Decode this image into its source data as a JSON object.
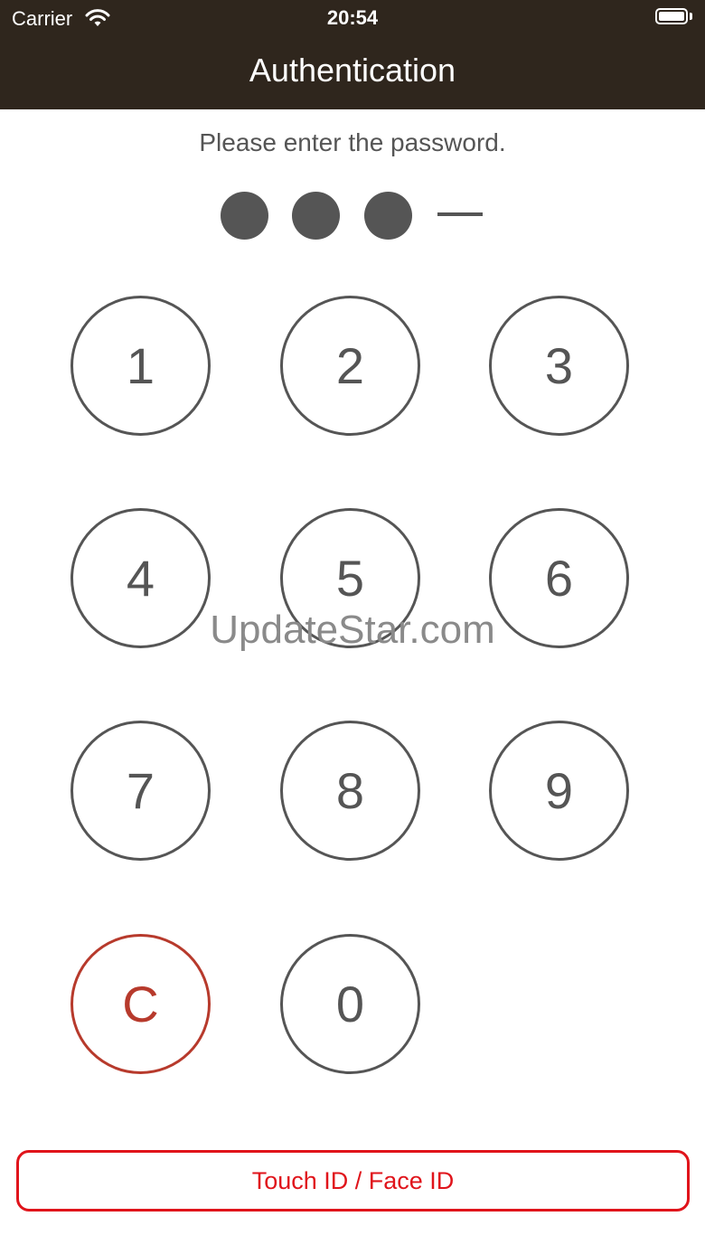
{
  "status_bar": {
    "carrier": "Carrier",
    "time": "20:54"
  },
  "nav": {
    "title": "Authentication"
  },
  "prompt": "Please enter the password.",
  "pin": {
    "entered": 3,
    "length": 4
  },
  "keypad": {
    "keys": [
      "1",
      "2",
      "3",
      "4",
      "5",
      "6",
      "7",
      "8",
      "9",
      "C",
      "0"
    ]
  },
  "watermark": "UpdateStar.com",
  "biometric_button": {
    "label": "Touch ID / Face ID"
  },
  "colors": {
    "header_bg": "#2f261d",
    "key": "#555555",
    "clear_key": "#b73a2c",
    "biometric": "#e0141b"
  }
}
